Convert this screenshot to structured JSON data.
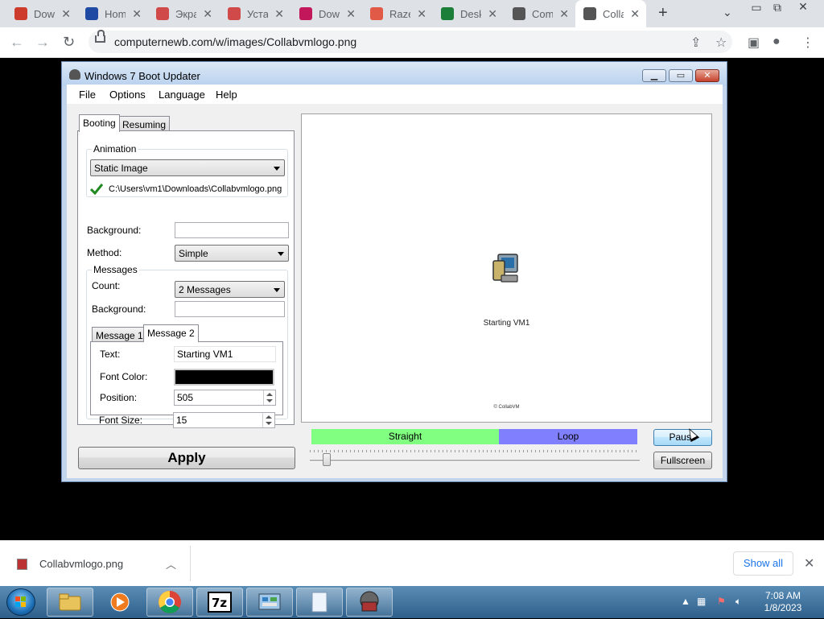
{
  "browser": {
    "tabs": [
      {
        "title": "Dow",
        "favicon_color": "#cc3b2b",
        "favicon_glyph": "windows-flag-icon"
      },
      {
        "title": "Hom",
        "favicon_color": "#1f4aa3",
        "favicon_glyph": "shield-icon"
      },
      {
        "title": "Экра",
        "favicon_color": "#d04a4a",
        "favicon_glyph": "seven-icon"
      },
      {
        "title": "Уста",
        "favicon_color": "#d04a4a",
        "favicon_glyph": "seven-icon"
      },
      {
        "title": "Dow",
        "favicon_color": "#c2185b",
        "favicon_glyph": "gem-icon"
      },
      {
        "title": "Raze",
        "favicon_color": "#e05a47",
        "favicon_glyph": "sp-icon"
      },
      {
        "title": "Desk",
        "favicon_color": "#1b7f3a",
        "favicon_glyph": "windows-flag-icon"
      },
      {
        "title": "Com",
        "favicon_color": "#555555",
        "favicon_glyph": "collabvm-icon"
      },
      {
        "title": "Colla",
        "favicon_color": "#555555",
        "favicon_glyph": "collabvm-icon"
      }
    ],
    "active_tab_index": 8,
    "url": "computernewb.com/w/images/Collabvmlogo.png"
  },
  "app": {
    "title": "Windows 7 Boot Updater",
    "menu": [
      "File",
      "Options",
      "Language",
      "Help"
    ],
    "tabs": {
      "booting": "Booting",
      "resuming": "Resuming"
    },
    "animation": {
      "group_label": "Animation",
      "type": "Static Image",
      "path": "C:\\Users\\vm1\\Downloads\\Collabvmlogo.png"
    },
    "background_label": "Background:",
    "background_value": "",
    "method_label": "Method:",
    "method_value": "Simple",
    "messages": {
      "group_label": "Messages",
      "count_label": "Count:",
      "count_value": "2 Messages",
      "background_label": "Background:",
      "background_value": "",
      "tab1": "Message 1",
      "tab2": "Message 2",
      "text_label": "Text:",
      "text_value": "Starting VM1",
      "font_color_label": "Font Color:",
      "font_color": "#000000",
      "position_label": "Position:",
      "position_value": "505",
      "font_size_label": "Font Size:",
      "font_size_value": "15"
    },
    "preview": {
      "message": "Starting VM1",
      "copyright": "© CollabVM"
    },
    "straight_label": "Straight",
    "loop_label": "Loop",
    "apply_label": "Apply",
    "pause_label": "Pause",
    "fullscreen_label": "Fullscreen"
  },
  "download": {
    "filename": "Collabvmlogo.png",
    "show_all": "Show all"
  },
  "taskbar": {
    "time": "7:08 AM",
    "date": "1/8/2023"
  }
}
